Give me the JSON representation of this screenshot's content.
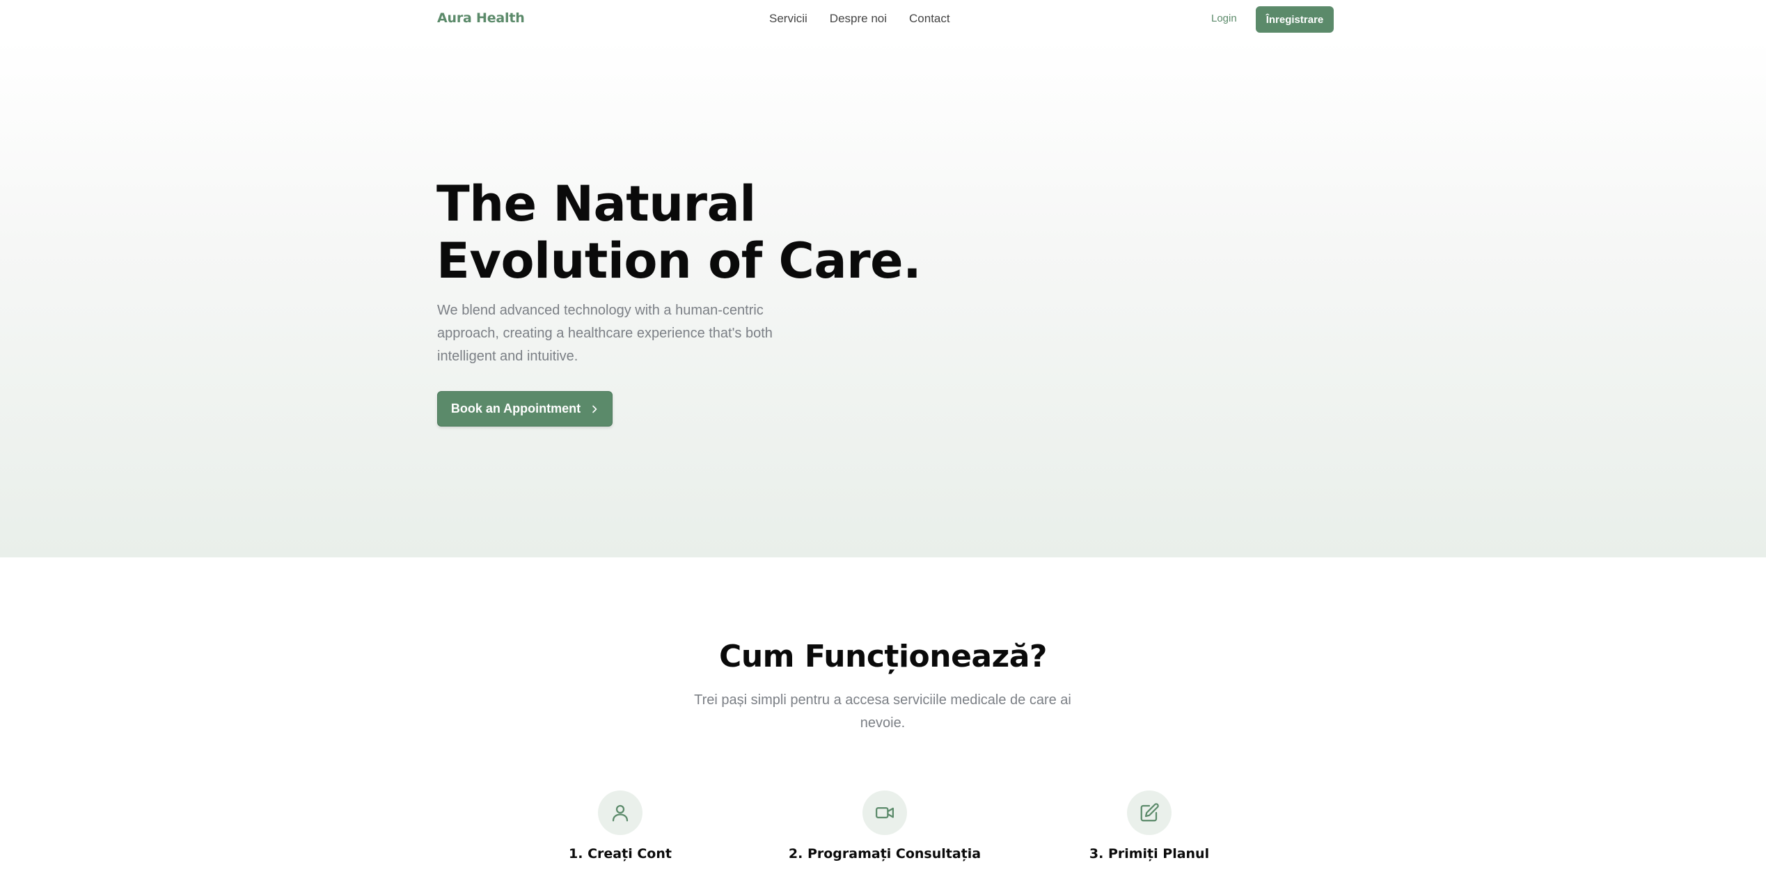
{
  "header": {
    "logo": "Aura Health",
    "nav": [
      "Servicii",
      "Despre noi",
      "Contact"
    ],
    "login_label": "Login",
    "register_label": "Înregistrare"
  },
  "hero": {
    "title_line1": "The Natural",
    "title_line2": "Evolution of Care.",
    "subtitle": "We blend advanced technology with a human-centric approach, creating a healthcare experience that's both intelligent and intuitive.",
    "cta_label": "Book an Appointment"
  },
  "how_it_works": {
    "title": "Cum Funcționează?",
    "subtitle": "Trei pași simpli pentru a accesa serviciile medicale de care ai nevoie.",
    "steps": [
      {
        "title": "1. Creați Cont",
        "icon": "user-icon"
      },
      {
        "title": "2. Programați Consultația",
        "icon": "video-camera-icon"
      },
      {
        "title": "3. Primiți Planul",
        "icon": "edit-icon"
      }
    ]
  },
  "colors": {
    "accent": "#5b8a6a",
    "icon_bg": "#eaf0eb",
    "text_muted": "#7b7f85"
  }
}
